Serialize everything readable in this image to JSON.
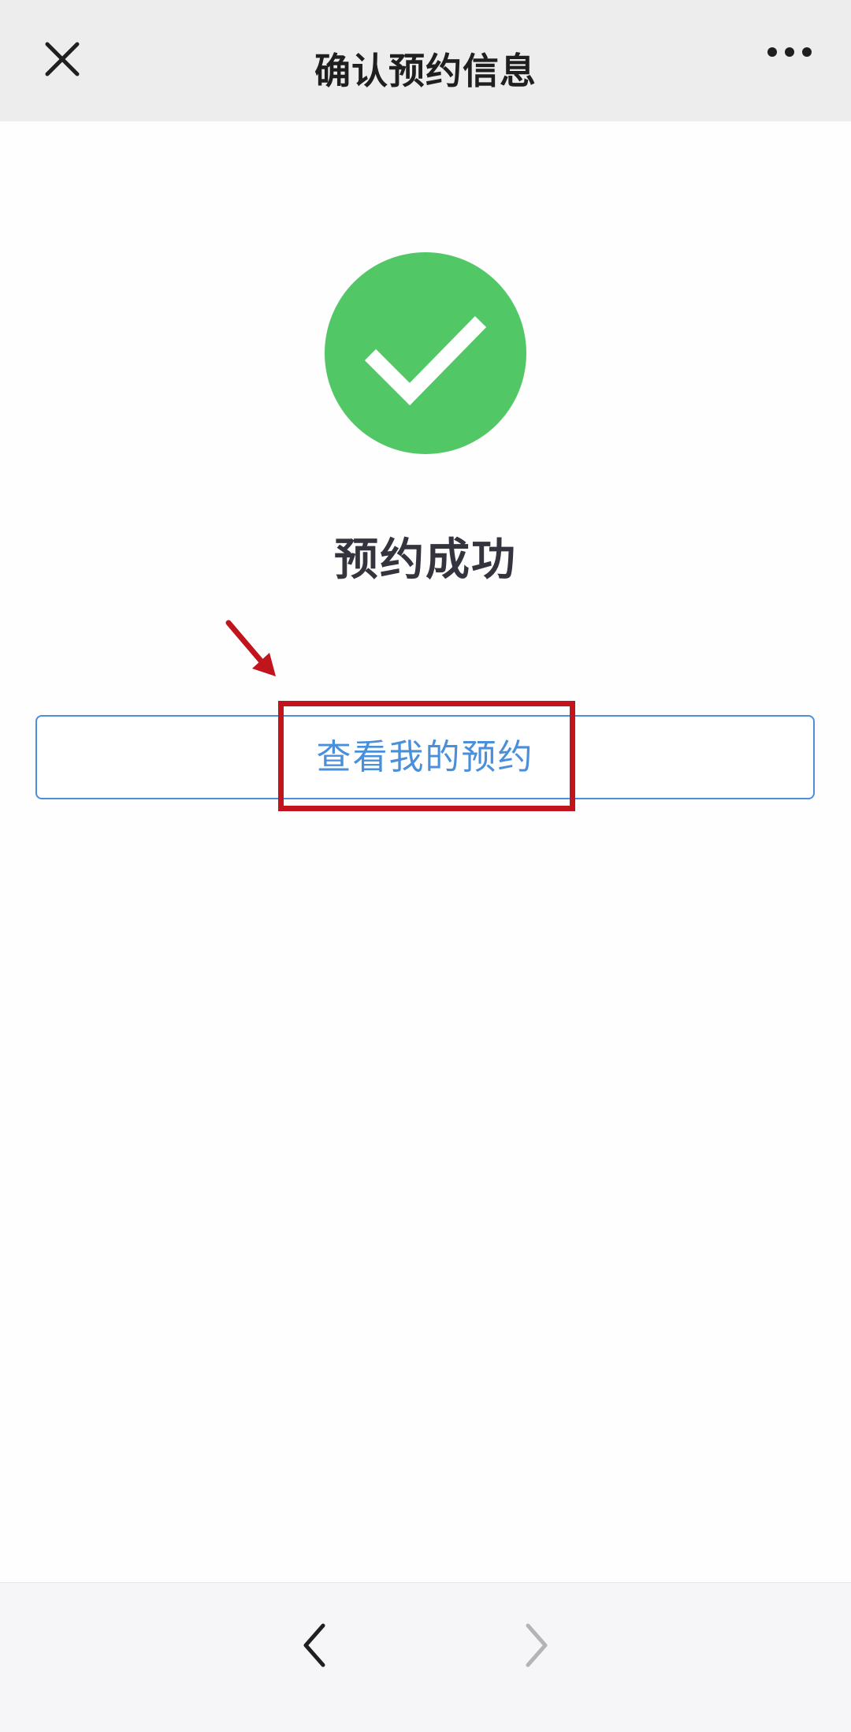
{
  "header": {
    "title": "确认预约信息",
    "close_icon": "close-icon",
    "more_icon": "more-horizontal-icon"
  },
  "status": {
    "icon": "checkmark-circle-icon",
    "icon_color": "#52c766",
    "message": "预约成功"
  },
  "actions": {
    "view_appointments_label": "查看我的预约",
    "button_color": "#4a8fd9"
  },
  "annotation": {
    "color": "#c0151c",
    "arrow_icon": "arrow-down-right-icon"
  },
  "bottom_nav": {
    "back_icon": "chevron-left-icon",
    "forward_icon": "chevron-right-icon"
  }
}
